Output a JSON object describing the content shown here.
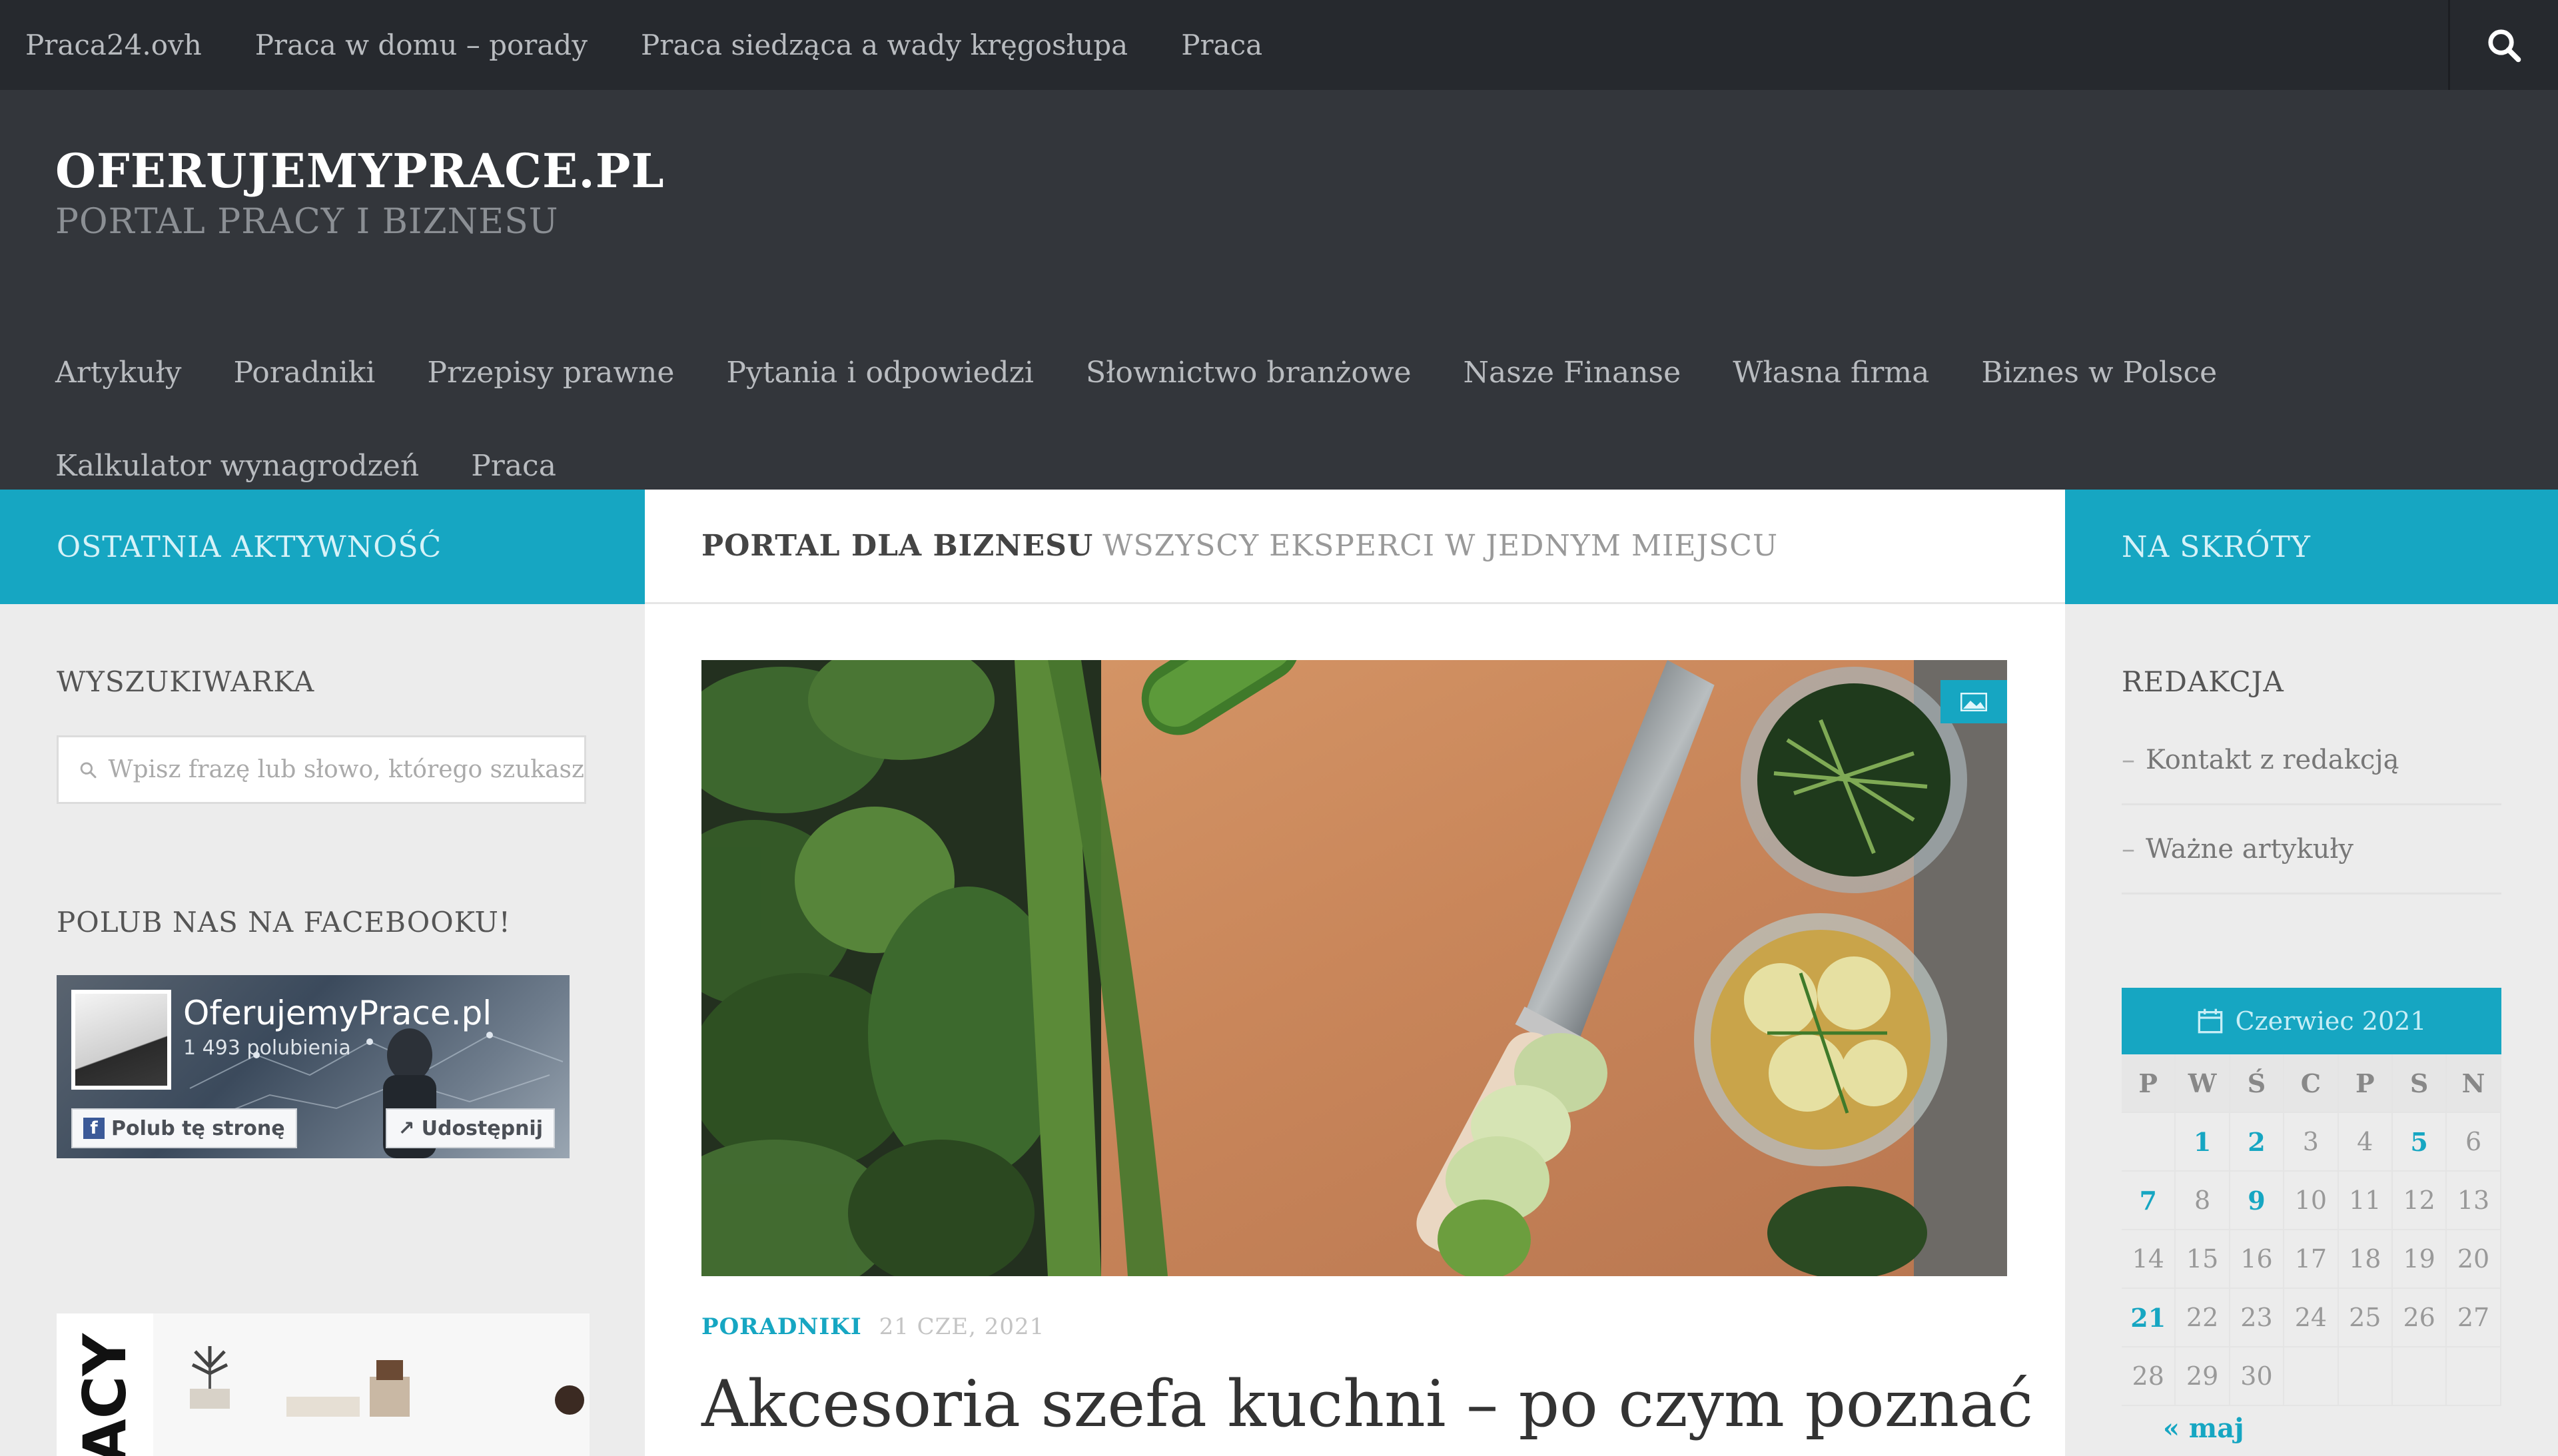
{
  "colors": {
    "accent": "#16a6c2",
    "topbar": "#26292e",
    "header": "#33363b",
    "sidebar": "#ececec"
  },
  "topbar": {
    "items": [
      "Praca24.ovh",
      "Praca w domu – porady",
      "Praca siedząca a wady kręgosłupa",
      "Praca"
    ],
    "search_icon": "search-icon"
  },
  "header": {
    "title": "OFERUJEMYPRACE.PL",
    "tagline": "PORTAL PRACY I BIZNESU"
  },
  "mainnav": [
    "Artykuły",
    "Poradniki",
    "Przepisy prawne",
    "Pytania i odpowiedzi",
    "Słownictwo branżowe",
    "Nasze Finanse",
    "Własna firma",
    "Biznes w Polsce",
    "Kalkulator wynagrodzeń",
    "Praca"
  ],
  "left_sidebar": {
    "header": "OSTATNIA AKTYWNOŚĆ",
    "search_title": "WYSZUKIWARKA",
    "search_placeholder": "Wpisz frazę lub słowo, którego szukasz",
    "facebook_title": "POLUB NAS NA FACEBOOKU!",
    "facebook": {
      "page_name": "OferujemyPrace.pl",
      "likes": "1 493 polubienia",
      "like_button": "Polub tę stronę",
      "share_button": "Udostępnij"
    },
    "ad_text": "RACY"
  },
  "center": {
    "heading_strong": "PORTAL DLA BIZNESU",
    "heading_light": "WSZYSCY EKSPERCI W JEDNYM MIEJSCU",
    "post": {
      "category": "PORADNIKI",
      "date": "21 CZE, 2021",
      "title": "Akcesoria szefa kuchni – po czym poznać"
    }
  },
  "right_sidebar": {
    "header": "NA SKRÓTY",
    "section_title": "REDAKCJA",
    "links": [
      "Kontakt z redakcją",
      "Ważne artykuły"
    ],
    "calendar": {
      "caption": "Czerwiec 2021",
      "weekdays": [
        "P",
        "W",
        "Ś",
        "C",
        "P",
        "S",
        "N"
      ],
      "rows": [
        [
          {
            "d": ""
          },
          {
            "d": "1",
            "link": true
          },
          {
            "d": "2",
            "link": true
          },
          {
            "d": "3"
          },
          {
            "d": "4"
          },
          {
            "d": "5",
            "link": true
          },
          {
            "d": "6"
          }
        ],
        [
          {
            "d": "7",
            "link": true
          },
          {
            "d": "8"
          },
          {
            "d": "9",
            "link": true
          },
          {
            "d": "10"
          },
          {
            "d": "11"
          },
          {
            "d": "12"
          },
          {
            "d": "13"
          }
        ],
        [
          {
            "d": "14"
          },
          {
            "d": "15"
          },
          {
            "d": "16"
          },
          {
            "d": "17"
          },
          {
            "d": "18"
          },
          {
            "d": "19"
          },
          {
            "d": "20"
          }
        ],
        [
          {
            "d": "21",
            "link": true
          },
          {
            "d": "22"
          },
          {
            "d": "23"
          },
          {
            "d": "24"
          },
          {
            "d": "25"
          },
          {
            "d": "26"
          },
          {
            "d": "27"
          }
        ],
        [
          {
            "d": "28"
          },
          {
            "d": "29"
          },
          {
            "d": "30"
          },
          {
            "d": ""
          },
          {
            "d": ""
          },
          {
            "d": ""
          },
          {
            "d": ""
          }
        ]
      ],
      "prev_link": "« maj"
    }
  }
}
